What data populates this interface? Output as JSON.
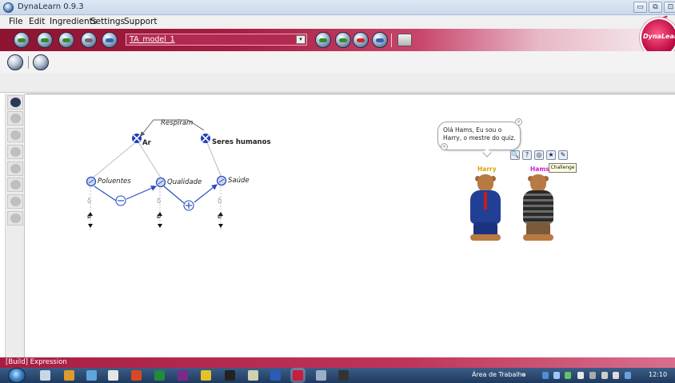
{
  "window": {
    "title": "DynaLearn 0.9.3",
    "buttons": [
      "▭",
      "⧉",
      "⊡"
    ]
  },
  "menu": [
    "File",
    "Edit",
    "Ingredients",
    "Settings",
    "Support"
  ],
  "toolbar": {
    "model_name": "TA_model_1",
    "dropdown_arrow": "▾",
    "left_buttons": [
      "back-icon",
      "forward-icon",
      "refresh-icon",
      "close-icon",
      "help-icon"
    ],
    "right_buttons": [
      "simulate-icon",
      "run-icon",
      "stop-icon",
      "question-icon"
    ],
    "print_icon": "print-icon",
    "logo_text": "DynaLearn"
  },
  "secondary_toolbar": [
    "build-icon",
    "network-icon"
  ],
  "palette": [
    "entity-icon",
    "quantity-icon",
    "configuration-icon",
    "influence-icon",
    "proportionality-icon",
    "positive-icon",
    "negative-icon",
    "flag-icon"
  ],
  "model": {
    "entities": [
      {
        "name": "Ar"
      },
      {
        "name": "Seres humanos"
      }
    ],
    "configuration": "Respiram",
    "quantities": [
      {
        "name": "Poluentes",
        "value": "δ"
      },
      {
        "name": "Qualidade",
        "value": "δ"
      },
      {
        "name": "Saúde",
        "value": "δ"
      }
    ],
    "proportionalities": [
      "−",
      "+"
    ],
    "derivative_symbol": "ø"
  },
  "agents": {
    "speech": "Olá Hams, Eu sou o Harry, o mestre do quiz.",
    "close_symbol": "×",
    "tools": [
      "🔍",
      "?",
      "◎",
      "★",
      "✎"
    ],
    "tooltip": "Challenge",
    "names": [
      "Harry",
      "Hams"
    ]
  },
  "statusbar": {
    "text": "[Build] Expression"
  },
  "taskbar": {
    "desktop_label": "Área de Trabalho",
    "chevron": "»",
    "clock": "12:10"
  }
}
